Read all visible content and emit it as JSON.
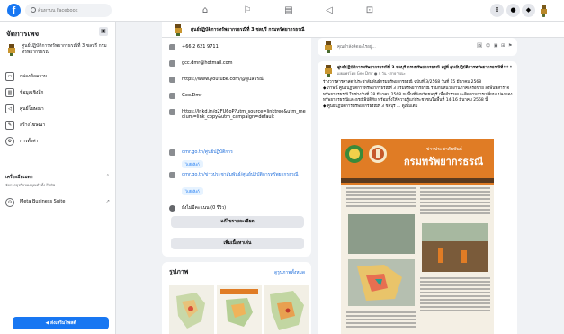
{
  "topbar": {
    "search_placeholder": "ค้นหาบน Facebook",
    "nav_icons": [
      "home-icon",
      "flag-icon",
      "marketplace-icon",
      "megaphone-icon",
      "video-icon"
    ],
    "right_icons": [
      "menu-grid-icon",
      "messenger-icon",
      "notifications-icon"
    ]
  },
  "sidebar": {
    "title": "จัดการเพจ",
    "page_name": "ศูนย์ปฏิบัติการทรัพยากรธรณีที่ 3 ชลบุรี กรมทรัพยากรธรณี",
    "items": [
      {
        "icon": "inbox-icon",
        "label": "กล่องข้อความ"
      },
      {
        "icon": "insights-icon",
        "label": "ข้อมูลเชิงลึก"
      },
      {
        "icon": "ads-center-icon",
        "label": "ศูนย์โฆษณา"
      },
      {
        "icon": "create-ad-icon",
        "label": "สร้างโฆษณา"
      },
      {
        "icon": "settings-icon",
        "label": "การตั้งค่า"
      }
    ],
    "tools_title": "เครื่องมือเมตา",
    "tools_subtitle": "จัดการธุรกิจของคุณทั่วทั้ง Meta",
    "meta_suite": "Meta Business Suite",
    "promote_button": "ส่งเสริมโพสต์"
  },
  "page_header": {
    "name": "ศูนย์ปฏิบัติการทรัพยากรธรณีที่ 3 ชลบุรี กรมทรัพยากรธรณี"
  },
  "intro": {
    "phone": "+66 2 621 9711",
    "email": "gcc.dmr@hotmail.com",
    "youtube": "https://www.youtube.com/@ดูแลธรณี",
    "gov": "Geo.Dmr",
    "bio_link": "https://lnkd.in/g2FU6oP?utm_source=linktree&utm_medium=link_copy&utm_campaign=default",
    "link1": "dmr.go.th/ศูนย์ปฏิบัติการ",
    "pill1": "ไปยังลิงก์",
    "link2": "dmr.go.th/ข่าวประชาสัมพันธ์/ศูนย์ปฏิบัติการทรัพยากรธรณี",
    "pill2": "ไปยังลิงก์",
    "rating": "ยังไม่มีคะแนน (0 รีวิว)",
    "edit_details": "แก้ไขรายละเอียด",
    "add_featured": "เพิ่มเนื้อหาเด่น"
  },
  "photos": {
    "title": "รูปภาพ",
    "see_all": "ดูรูปภาพทั้งหมด"
  },
  "composer": {
    "placeholder": "คุณกำลังคิดอะไรอยู่...",
    "actions": "🖼 ☺ ▣ ⊞ ⚑"
  },
  "post": {
    "author": "ศูนย์ปฏิบัติการทรัพยากรธรณีที่ 3 ชลบุรี กรมทรัพยากรธรณี อยู่ที่ ศูนย์ปฏิบัติการทรัพยากรธรณีที่ 3",
    "meta": "เผยแพร่โดย Geo Dmr ● 4 วัน · สาธารณะ",
    "paragraph1": "ร่างวารสารศาสตร์ประชาสัมพันธ์กรมทรัพยากรธรณี ฉบับที่ 3/2568 วันที่ 15 มีนาคม 2568",
    "paragraph2": "◆ ภาพนี้ ศูนย์ปฏิบัติการทรัพยากรธรณีที่ 3 กรมทรัพยากรธรณี ร่วมกับหน่วยงานภาคีเครือข่าย ลงพื้นที่สำรวจทรัพยากรธรณี ในช่วงวันที่ 28 มีนาคม 2568 ณ พื้นที่จังหวัดชลบุรี เพื่อสำรวจและติดตามการเปลี่ยนแปลงของทรัพยากรธรณีและธรณีพิบัติภัย พร้อมทั้งให้ความรู้แก่ประชาชนในพื้นที่ 14-16 มีนาคม 2568 นี้",
    "paragraph3": "◆ ศูนย์ปฏิบัติการทรัพยากรธรณีที่ 3 ชลบุรี ... ดูเพิ่มเติม",
    "image_subtitle": "ข่าวประชาสัมพันธ์",
    "image_title": "กรมทรัพยากรธรณี"
  },
  "colors": {
    "brand": "#1877f2",
    "link": "#216fdb",
    "orange": "#e07c25"
  }
}
